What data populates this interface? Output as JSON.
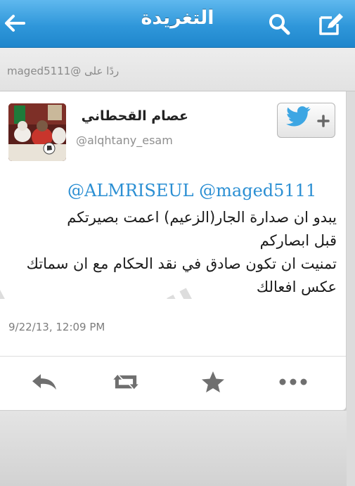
{
  "navbar": {
    "title": "التغريدة",
    "back_icon": "back-arrow-icon",
    "search_icon": "search-icon",
    "compose_icon": "compose-icon"
  },
  "reply_context": {
    "text": "ردًا على @maged5111"
  },
  "tweet": {
    "display_name": "عصام القحطاني",
    "username": "@alqhtany_esam",
    "follow_icon": "twitter-bird-plus-icon",
    "mentions": "@ALMRISEUL @maged5111",
    "body": "يبدو ان صدارة الجار(الزعيم) اعمت بصيرتكم\nقبل ابصاركم\nتمنيت ان تكون صادق في نقد الحكام مع ان سماتك\nعكس افعالك",
    "timestamp": "9/22/13, 12:09 PM",
    "actions": [
      "reply-icon",
      "retweet-icon",
      "favorite-star-icon",
      "more-dots-icon"
    ]
  },
  "watermark": {
    "text": "الوئام"
  },
  "colors": {
    "nav_blue": "#2f97da",
    "link_blue": "#2b8fd3",
    "twitter_bird": "#3da6e3"
  }
}
